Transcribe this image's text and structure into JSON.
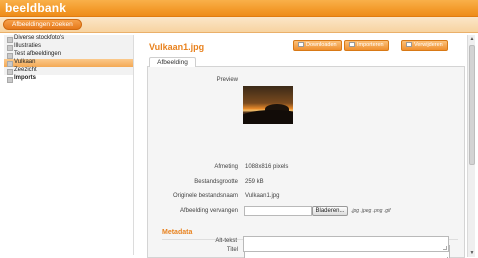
{
  "header": {
    "logo": "beeldbank"
  },
  "toolbar": {
    "search_label": "Afbeeldingen zoeken"
  },
  "sidebar": {
    "items": [
      {
        "label": "Diverse stockfoto's"
      },
      {
        "label": "Illustraties"
      },
      {
        "label": "Test afbeeldingen"
      },
      {
        "label": "Vulkaan"
      },
      {
        "label": "Zeezicht"
      },
      {
        "label": "Imports"
      }
    ],
    "selected": "Vulkaan"
  },
  "main": {
    "title": "Vulkaan1.jpg",
    "buttons": {
      "download": "Downloaden",
      "import": "Importeren",
      "delete": "Verwijderen"
    },
    "tab": "Afbeelding",
    "fields": {
      "preview_label": "Preview",
      "dimensions_label": "Afmeting",
      "dimensions_value": "1088x816 pixels",
      "filesize_label": "Bestandsgrootte",
      "filesize_value": "259 kB",
      "filename_label": "Originele bestandsnaam",
      "filename_value": "Vulkaan1.jpg",
      "replace_label": "Afbeelding vervangen",
      "browse_label": "Bladeren...",
      "allowed_types": ".jpg .jpeg .png .gif"
    },
    "metadata": {
      "section_title": "Metadata",
      "title_label": "Titel",
      "title_value": "",
      "alt_label": "Alt-tekst",
      "alt_value": ""
    }
  },
  "scrollbar": {
    "up_icon": "▲",
    "down_icon": "▼"
  }
}
